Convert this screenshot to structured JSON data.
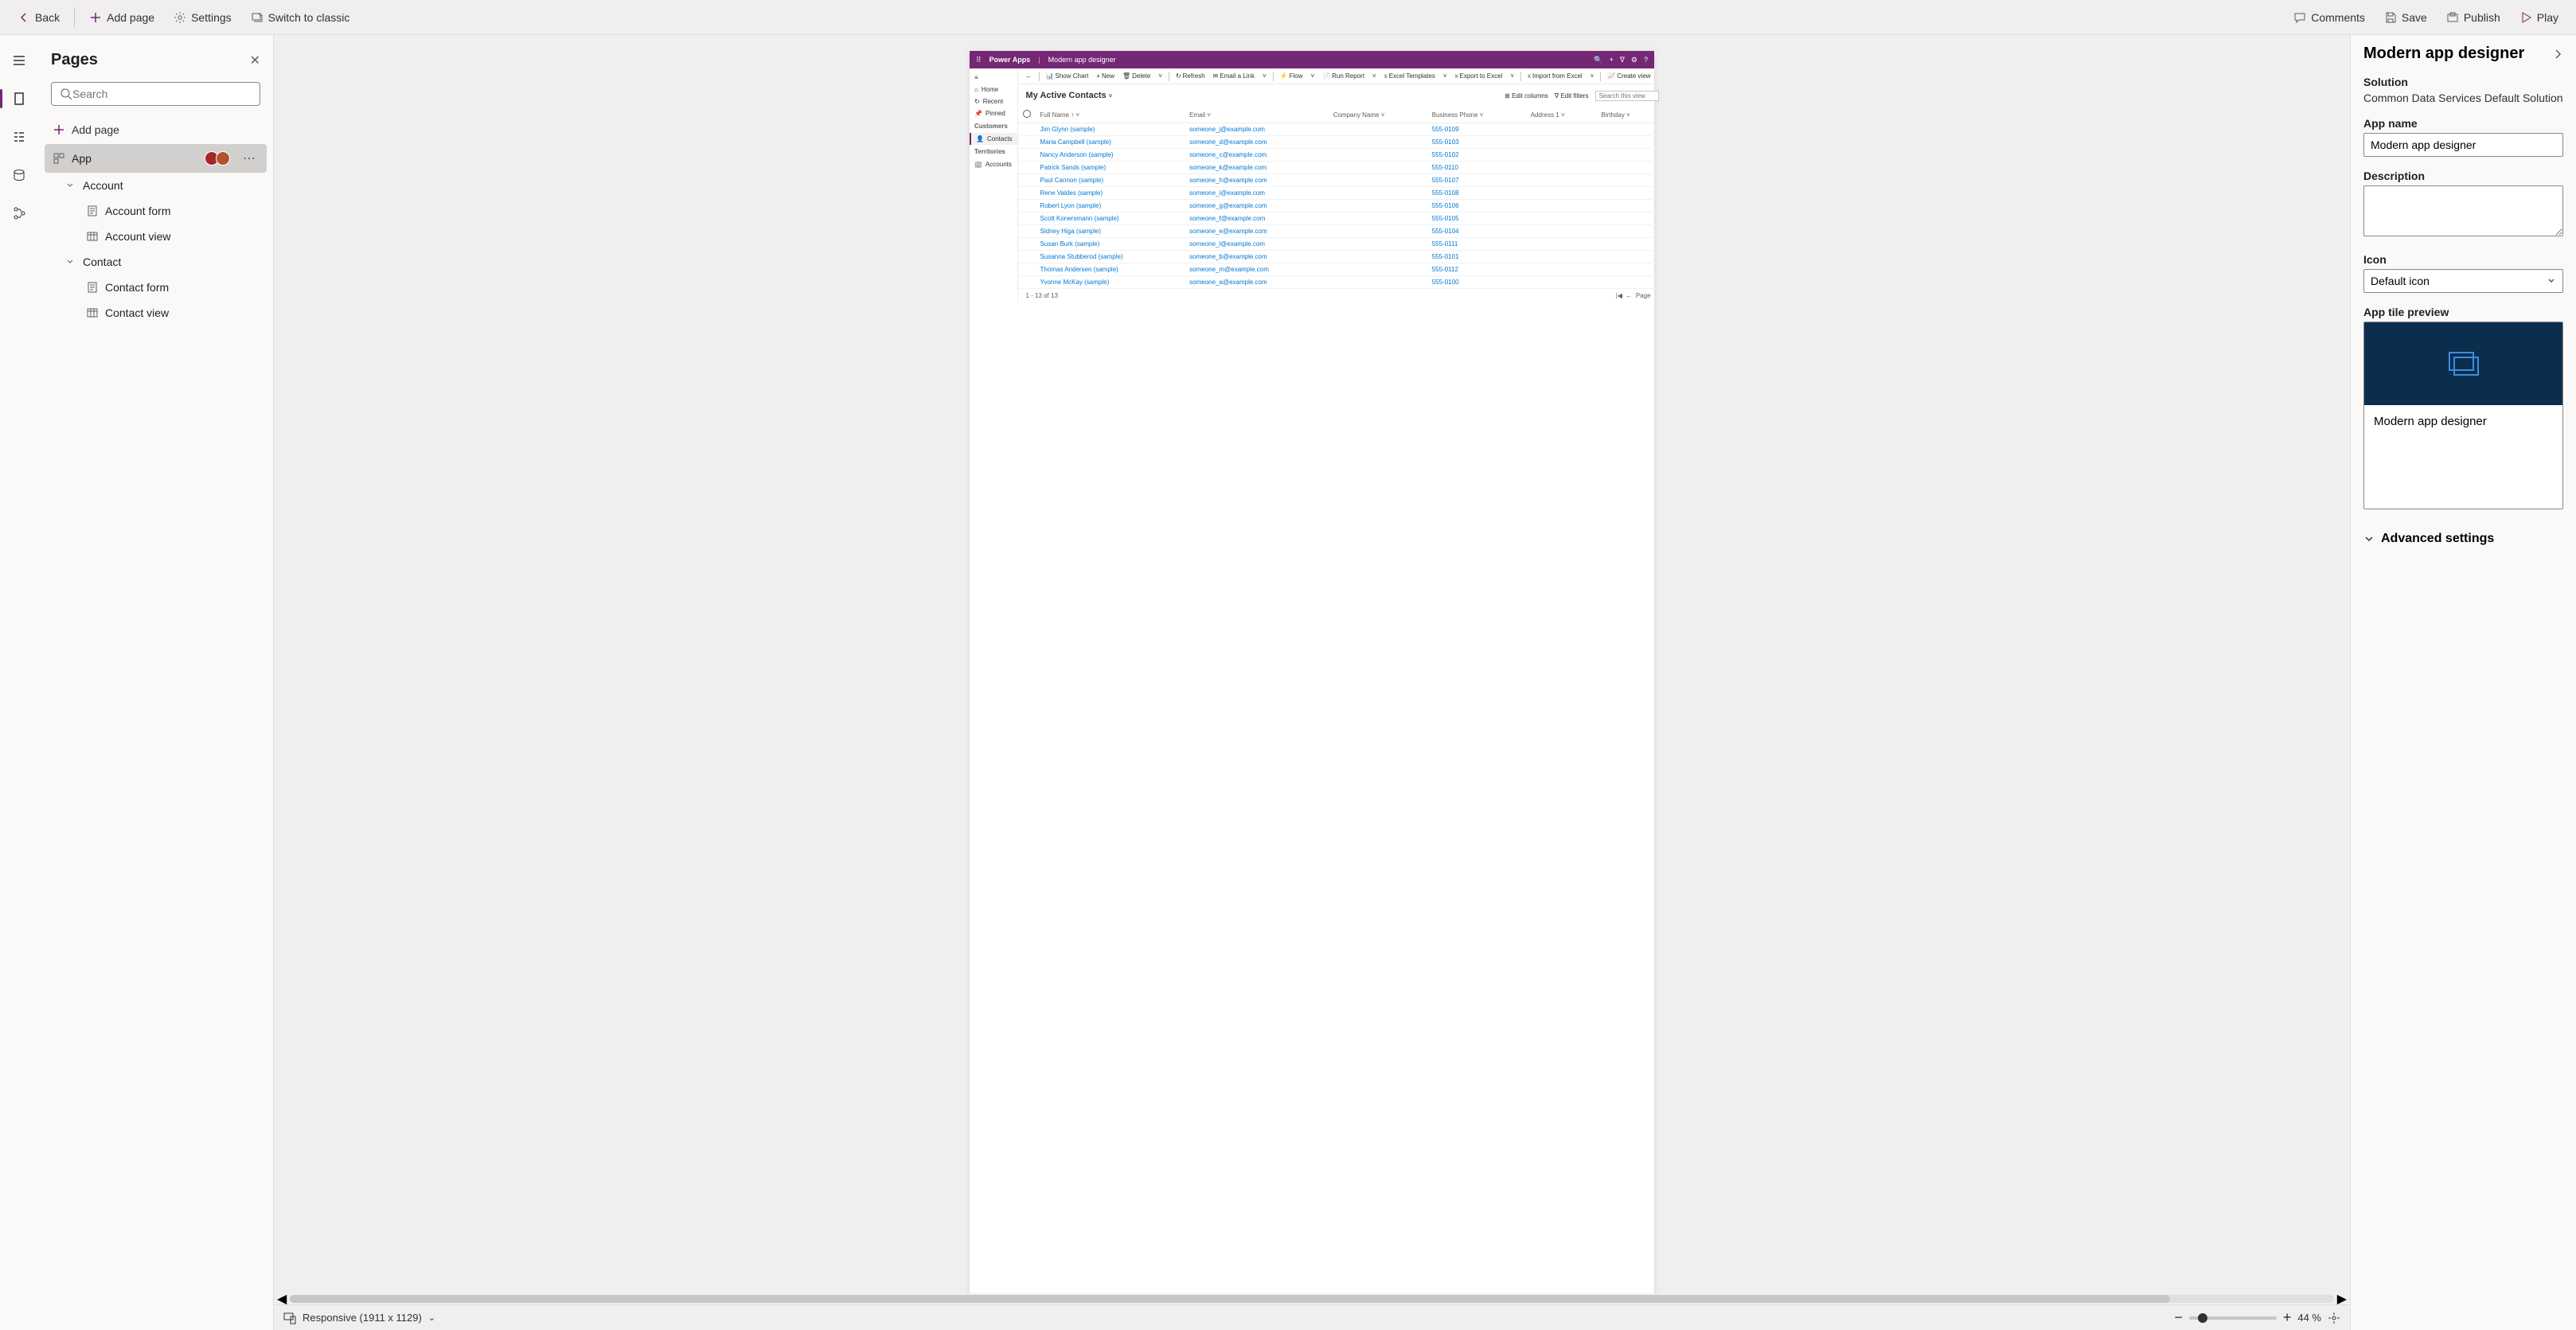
{
  "toolbar": {
    "back": "Back",
    "add_page": "Add page",
    "settings": "Settings",
    "switch_classic": "Switch to classic",
    "comments": "Comments",
    "save": "Save",
    "publish": "Publish",
    "play": "Play"
  },
  "left_panel": {
    "title": "Pages",
    "search_placeholder": "Search",
    "add_page": "Add page",
    "tree": {
      "app": "App",
      "account": "Account",
      "account_form": "Account form",
      "account_view": "Account view",
      "contact": "Contact",
      "contact_form": "Contact form",
      "contact_view": "Contact view"
    }
  },
  "preview": {
    "brand": "Power Apps",
    "app_name": "Modern app designer",
    "nav": {
      "home": "Home",
      "recent": "Recent",
      "pinned": "Pinned",
      "group_customers": "Customers",
      "contacts": "Contacts",
      "group_territories": "Territories",
      "accounts": "Accounts"
    },
    "cmdbar": {
      "show_chart": "Show Chart",
      "new": "New",
      "delete": "Delete",
      "refresh": "Refresh",
      "email_link": "Email a Link",
      "flow": "Flow",
      "run_report": "Run Report",
      "excel_templates": "Excel Templates",
      "export_excel": "Export to Excel",
      "import_excel": "Import from Excel",
      "create_view": "Create view"
    },
    "view_name": "My Active Contacts",
    "tools": {
      "edit_columns": "Edit columns",
      "edit_filters": "Edit filters",
      "search_placeholder": "Search this view"
    },
    "columns": {
      "full_name": "Full Name",
      "email": "Email",
      "company": "Company Name",
      "business_phone": "Business Phone",
      "address1": "Address 1",
      "birthday": "Birthday"
    },
    "rows": [
      {
        "name": "Jim Glynn (sample)",
        "email": "someone_j@example.com",
        "phone": "555-0109"
      },
      {
        "name": "Maria Campbell (sample)",
        "email": "someone_d@example.com",
        "phone": "555-0103"
      },
      {
        "name": "Nancy Anderson (sample)",
        "email": "someone_c@example.com",
        "phone": "555-0102"
      },
      {
        "name": "Patrick Sands (sample)",
        "email": "someone_k@example.com",
        "phone": "555-0110"
      },
      {
        "name": "Paul Cannon (sample)",
        "email": "someone_h@example.com",
        "phone": "555-0107"
      },
      {
        "name": "Rene Valdes (sample)",
        "email": "someone_i@example.com",
        "phone": "555-0108"
      },
      {
        "name": "Robert Lyon (sample)",
        "email": "someone_g@example.com",
        "phone": "555-0106"
      },
      {
        "name": "Scott Konersmann (sample)",
        "email": "someone_f@example.com",
        "phone": "555-0105"
      },
      {
        "name": "Sidney Higa (sample)",
        "email": "someone_e@example.com",
        "phone": "555-0104"
      },
      {
        "name": "Susan Burk (sample)",
        "email": "someone_l@example.com",
        "phone": "555-0111"
      },
      {
        "name": "Susanna Stubberod (sample)",
        "email": "someone_b@example.com",
        "phone": "555-0101"
      },
      {
        "name": "Thomas Andersen (sample)",
        "email": "someone_m@example.com",
        "phone": "555-0112"
      },
      {
        "name": "Yvonne McKay (sample)",
        "email": "someone_a@example.com",
        "phone": "555-0100"
      }
    ],
    "footer_left": "1 - 13 of 13",
    "footer_right_page": "Page"
  },
  "status": {
    "responsive": "Responsive (1911 x 1129)",
    "zoom_pct": "44 %"
  },
  "right_panel": {
    "title": "Modern app designer",
    "solution_label": "Solution",
    "solution_value": "Common Data Services Default Solution",
    "app_name_label": "App name",
    "app_name_value": "Modern app designer",
    "description_label": "Description",
    "description_value": "",
    "icon_label": "Icon",
    "icon_value": "Default icon",
    "tile_preview_label": "App tile preview",
    "tile_name": "Modern app designer",
    "advanced": "Advanced settings"
  }
}
